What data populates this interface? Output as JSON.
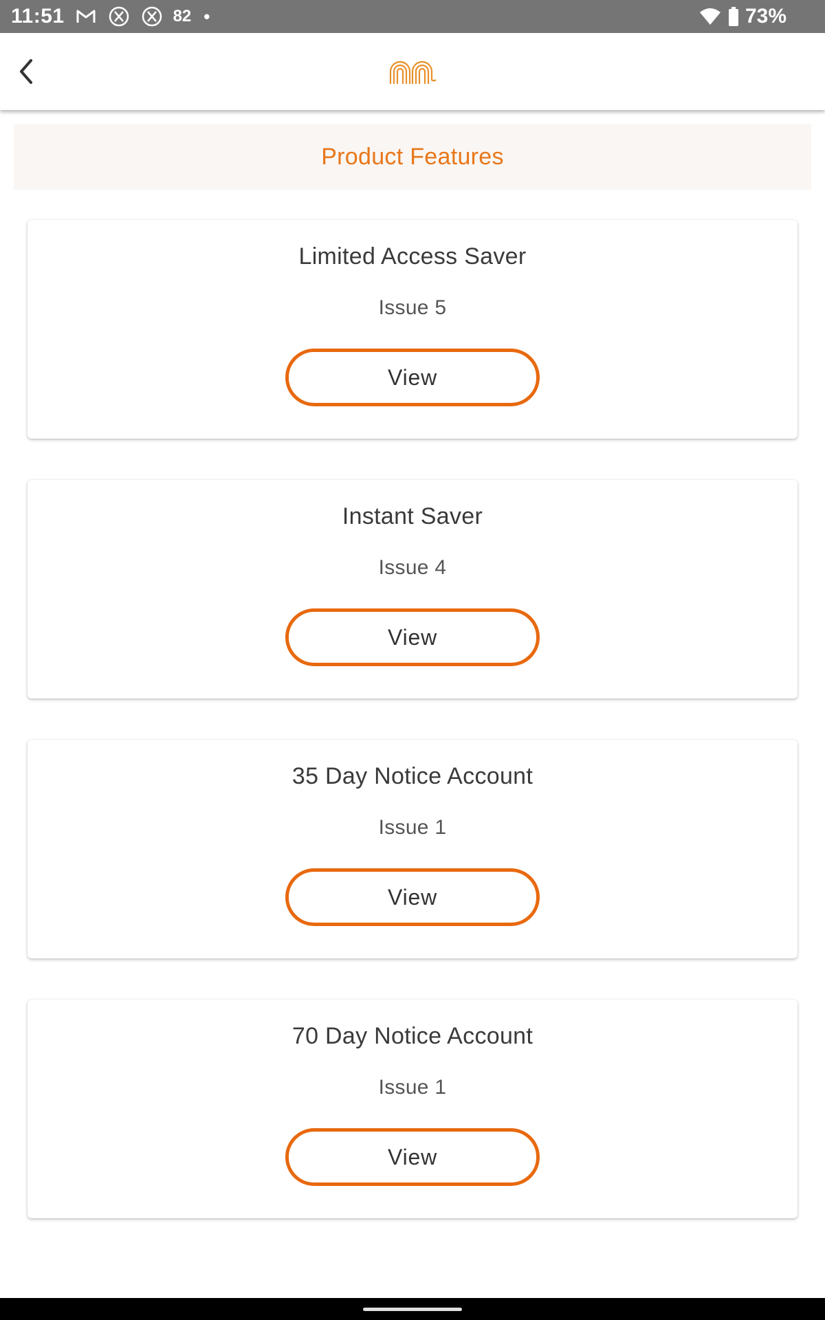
{
  "status_bar": {
    "time": "11:51",
    "notification_count": "82",
    "battery": "73%",
    "icons": [
      "gmail-icon",
      "x-app-icon",
      "x-app-icon",
      "dot-icon",
      "wifi-icon",
      "battery-icon"
    ]
  },
  "app_bar": {
    "back_icon": "chevron-left-icon",
    "logo_icon": "brand-logo-arches"
  },
  "page": {
    "section_title": "Product Features"
  },
  "products": [
    {
      "name": "Limited Access Saver",
      "issue": "Issue 5",
      "button": "View"
    },
    {
      "name": "Instant Saver",
      "issue": "Issue 4",
      "button": "View"
    },
    {
      "name": "35 Day Notice Account",
      "issue": "Issue 1",
      "button": "View"
    },
    {
      "name": "70 Day Notice Account",
      "issue": "Issue 1",
      "button": "View"
    }
  ],
  "colors": {
    "accent": "#e8771a",
    "button_border": "#e8690f",
    "status_bar": "#757575",
    "header_bg": "#f9f6f3"
  }
}
